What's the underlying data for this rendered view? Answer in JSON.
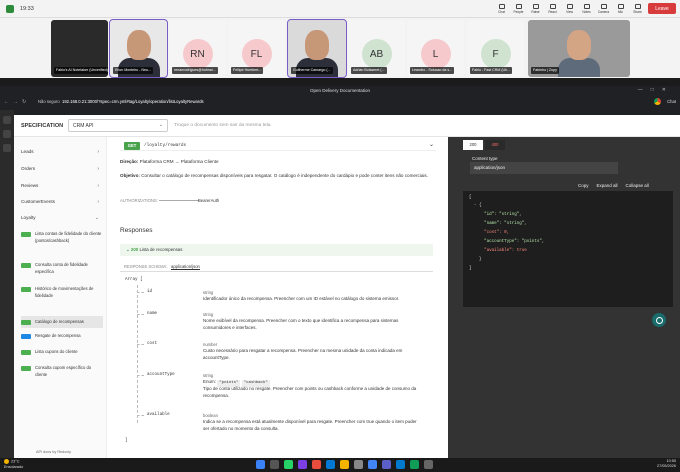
{
  "meeting": {
    "time": "19:33",
    "controls": [
      "Chat",
      "People",
      "Raise",
      "React",
      "View",
      "Notes",
      "Camera",
      "Mic",
      "Share"
    ],
    "leave_label": "Leave",
    "tiles": [
      {
        "label": "Fabio's AI Notetaker (Unverified)",
        "kind": "dark",
        "initials": ""
      },
      {
        "label": "Elton Monteiro - Neu...",
        "kind": "face",
        "initials": ""
      },
      {
        "label": "renanrodrigues@hotmai...",
        "kind": "initials",
        "initials": "RN",
        "color": "#f6c9cc"
      },
      {
        "label": "Fellipe Humbert...",
        "kind": "initials",
        "initials": "FL",
        "color": "#f6c9cc"
      },
      {
        "label": "Guilherme Camargo (...",
        "kind": "face",
        "initials": ""
      },
      {
        "label": "Adrian Buisseret (...",
        "kind": "initials",
        "initials": "AB",
        "color": "#cfe3d0"
      },
      {
        "label": "Leandro - Solucao da s...",
        "kind": "initials",
        "initials": "L",
        "color": "#f6c9cc"
      },
      {
        "label": "Fabio - Fast CRM (Uh...",
        "kind": "initials",
        "initials": "F",
        "color": "#cfe3d0"
      },
      {
        "label": "Fabinho | Zupy",
        "kind": "face",
        "initials": ""
      }
    ]
  },
  "browser": {
    "window_title": "Open Delivery Documentation",
    "url_prefix": "Não seguro",
    "url": "192.168.0.21:3000/?spec=crm.yml#tag/Loyalty/operation/listLoyaltyRewards",
    "profile_label": "Chat"
  },
  "spec": {
    "label": "SPECIFICATION",
    "selected": "CRM API",
    "hint": "Troque o documento sem sair da mesma tela."
  },
  "sidebar": {
    "items": [
      {
        "label": "Leads"
      },
      {
        "label": "Orders"
      },
      {
        "label": "Reviews"
      },
      {
        "label": "CustomerEvents"
      },
      {
        "label": "Loyalty"
      }
    ],
    "sub_items": [
      {
        "label": "Lista contas de fidelidade do cliente (pontos/cashback)"
      },
      {
        "label": "Consulta conta de fidelidade específica"
      },
      {
        "label": "Histórico de movimentações de fidelidade"
      },
      {
        "label": "Catálogo de recompensas"
      },
      {
        "label": "Resgate de recompensa"
      },
      {
        "label": "Lista cupons do cliente"
      },
      {
        "label": "Consulta cupom específico do cliente"
      }
    ],
    "footer": "API docs by Redocly"
  },
  "operation": {
    "method": "GET",
    "path": "/loyalty/rewards",
    "direction_label": "Direção:",
    "direction": "Plataforma CRM → Plataforma Cliente",
    "objective_label": "Objetivo:",
    "objective": "Consultar o catálogo de recompensas disponíveis para resgatar. O catálogo é independente do cardápio e pode conter itens não comerciais.",
    "auth_label": "AUTHORIZATIONS:",
    "auth_value": "BearerAuth",
    "responses_title": "Responses",
    "response_code": "200",
    "response_desc": "Lista de recompensas",
    "schema_label": "RESPONSE SCHEMA:",
    "schema_type": "application/json",
    "array_label": "Array [",
    "array_close": "]",
    "properties": [
      {
        "name": "id",
        "type": "string",
        "desc": "Identificador único da recompensa. Preencher com um ID estável no catálogo do sistema emissor."
      },
      {
        "name": "name",
        "type": "string",
        "desc": "Nome exibível da recompensa. Preencher com o texto que identifica a recompensa para sistemas consumidores e interfaces."
      },
      {
        "name": "cost",
        "type": "number",
        "desc": "Custo necessário para resgatar a recompensa. Preencher na mesma unidade da conta indicada em accountType."
      },
      {
        "name": "accountType",
        "type": "string",
        "enum_label": "Enum:",
        "enum": [
          "\"points\"",
          "\"cashback\""
        ],
        "desc": "Tipo de conta utilizado no resgate. Preencher com points ou cashback conforme a unidade de consumo da recompensa."
      },
      {
        "name": "available",
        "type": "boolean",
        "desc": "Indica se a recompensa está atualmente disponível para resgate. Preencher com true quando o item puder ser ofertado no momento da consulta."
      }
    ]
  },
  "response_panel": {
    "tabs": [
      "200",
      "400"
    ],
    "content_type_label": "Content type",
    "content_type": "application/json",
    "buttons": [
      "Copy",
      "Expand all",
      "Collapse all"
    ],
    "code_lines": [
      "[",
      "  - {",
      "      \"id\": \"string\",",
      "      \"name\": \"string\",",
      "      \"cost\": 0,",
      "      \"accountType\": \"points\",",
      "      \"available\": true",
      "    }",
      "]"
    ]
  },
  "taskbar": {
    "temp": "23°C",
    "weather": "Ensolarado",
    "time": "10:55",
    "date": "27/05/2026"
  }
}
